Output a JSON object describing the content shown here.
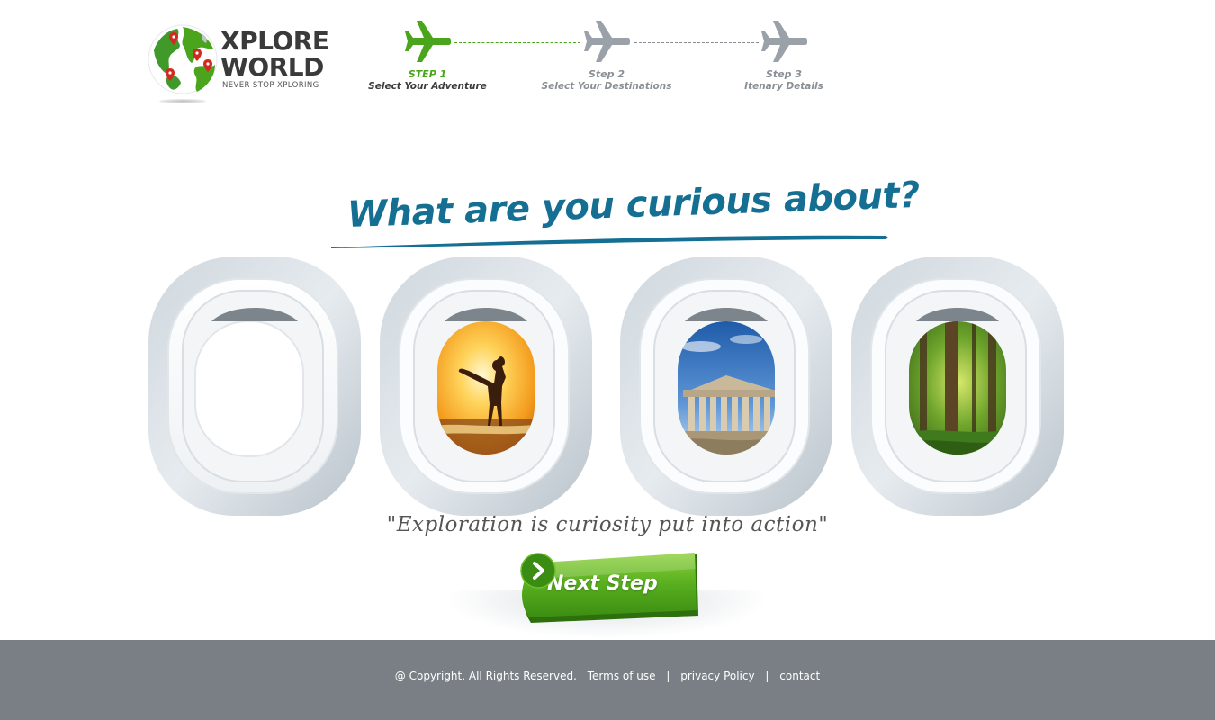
{
  "brand": {
    "title_line1": "XPLORE",
    "title_line2": "WORLD",
    "tagline": "NEVER STOP XPLORING"
  },
  "steps": [
    {
      "number": "STEP 1",
      "label": "Select Your Adventure",
      "active": true
    },
    {
      "number": "Step 2",
      "label": "Select Your Destinations",
      "active": false
    },
    {
      "number": "Step 3",
      "label": "Itenary Details",
      "active": false
    }
  ],
  "headline": "What are you curious about?",
  "windows": [
    {
      "scene": "empty-window"
    },
    {
      "scene": "sunset-beach-woman"
    },
    {
      "scene": "greek-temple-ruins"
    },
    {
      "scene": "green-forest"
    }
  ],
  "quote": "\"Exploration is curiosity put into action\"",
  "next_button": {
    "label": "Next Step"
  },
  "footer": {
    "copyright": "@ Copyright. All Rights Reserved.",
    "links": [
      "Terms of use",
      "privacy Policy",
      "contact"
    ]
  },
  "colors": {
    "brand_green": "#4aa51d",
    "headline_blue": "#146f93",
    "inactive_gray": "#8a8f96",
    "footer_gray": "#797f84"
  },
  "icons": [
    "globe-logo-icon",
    "airplane-icon",
    "chevron-right-icon"
  ]
}
